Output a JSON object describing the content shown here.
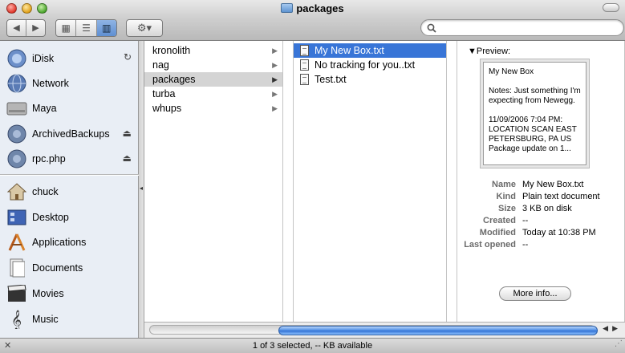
{
  "window": {
    "title": "packages"
  },
  "toolbar": {
    "back": "◀",
    "forward": "▶",
    "views": [
      "▦",
      "☰",
      "▥"
    ],
    "action": "⚙▾",
    "search_placeholder": ""
  },
  "sidebar": {
    "devices": [
      {
        "label": "iDisk",
        "icon": "idisk-icon",
        "extra": "↻"
      },
      {
        "label": "Network",
        "icon": "network-globe-icon",
        "extra": ""
      },
      {
        "label": "Maya",
        "icon": "hard-drive-icon",
        "extra": ""
      },
      {
        "label": "ArchivedBackups",
        "icon": "network-volume-icon",
        "extra": "⏏"
      },
      {
        "label": "rpc.php",
        "icon": "network-volume-icon",
        "extra": "⏏"
      }
    ],
    "places": [
      {
        "label": "chuck",
        "icon": "home-icon"
      },
      {
        "label": "Desktop",
        "icon": "desktop-icon"
      },
      {
        "label": "Applications",
        "icon": "applications-icon"
      },
      {
        "label": "Documents",
        "icon": "documents-icon"
      },
      {
        "label": "Movies",
        "icon": "movies-icon"
      },
      {
        "label": "Music",
        "icon": "music-icon"
      }
    ]
  },
  "column1": [
    {
      "label": "kronolith"
    },
    {
      "label": "nag"
    },
    {
      "label": "packages"
    },
    {
      "label": "turba"
    },
    {
      "label": "whups"
    }
  ],
  "column2": [
    {
      "label": "My New Box.txt"
    },
    {
      "label": "No tracking for you..txt"
    },
    {
      "label": "Test.txt"
    }
  ],
  "preview": {
    "label": "Preview:",
    "lines": [
      "My New Box",
      "Notes: Just something I'm expecting from Newegg.",
      "11/09/2006 7:04 PM: LOCATION SCAN EAST PETERSBURG, PA US Package update on 1..."
    ],
    "meta": [
      {
        "key": "Name",
        "value": "My New Box.txt"
      },
      {
        "key": "Kind",
        "value": "Plain text document"
      },
      {
        "key": "Size",
        "value": "3 KB on disk"
      },
      {
        "key": "Created",
        "value": "--"
      },
      {
        "key": "Modified",
        "value": "Today at 10:38 PM"
      },
      {
        "key": "Last opened",
        "value": "--"
      }
    ],
    "more_info": "More info..."
  },
  "status": {
    "text": "1 of 3 selected, -- KB available"
  },
  "colors": {
    "selection": "#3875d7",
    "sidebar": "#e9eef5"
  }
}
